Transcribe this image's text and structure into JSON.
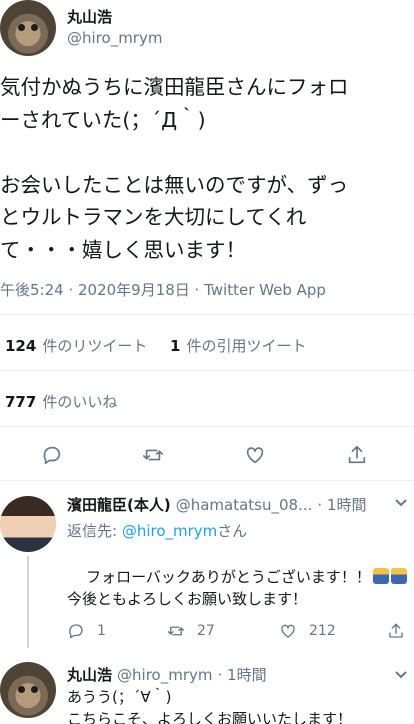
{
  "main_tweet": {
    "author_name": "丸山浩",
    "author_handle": "@hiro_mrym",
    "text": "気付かぬうちに濱田龍臣さんにフォロ\nーされていた(；´Д｀)\n\nお会いしたことは無いのですが、ずっ\nとウルトラマンを大切にしてくれ\nて・・・嬉しく思います！",
    "timestamp": "午後5:24 · 2020年9月18日 · Twitter Web App"
  },
  "stats": {
    "retweets_count": "124",
    "retweets_label": "件のリツイート",
    "quotes_count": "1",
    "quotes_label": "件の引用ツイート",
    "likes_count": "777",
    "likes_label": "件のいいね"
  },
  "actions": {
    "icons": [
      "reply-icon",
      "retweet-icon",
      "like-icon",
      "share-icon"
    ]
  },
  "replies": [
    {
      "author_name": "濱田龍臣(本人)",
      "author_handle": "@hamatatsu_08...",
      "time": "· 1時間",
      "replying_to_prefix": "返信先: ",
      "replying_to_handle": "@hiro_mrym",
      "replying_to_suffix": "さん",
      "text_line1": "フォローバックありがとうございます！！",
      "text_line2": "今後ともよろしくお願い致します！",
      "reply_count": "1",
      "retweet_count": "27",
      "like_count": "212"
    },
    {
      "author_name": "丸山浩",
      "author_handle": "@hiro_mrym",
      "time": "· 1時間",
      "text": "あうう(；´∀｀)\nこちらこそ、よろしくお願いいたします！"
    }
  ]
}
